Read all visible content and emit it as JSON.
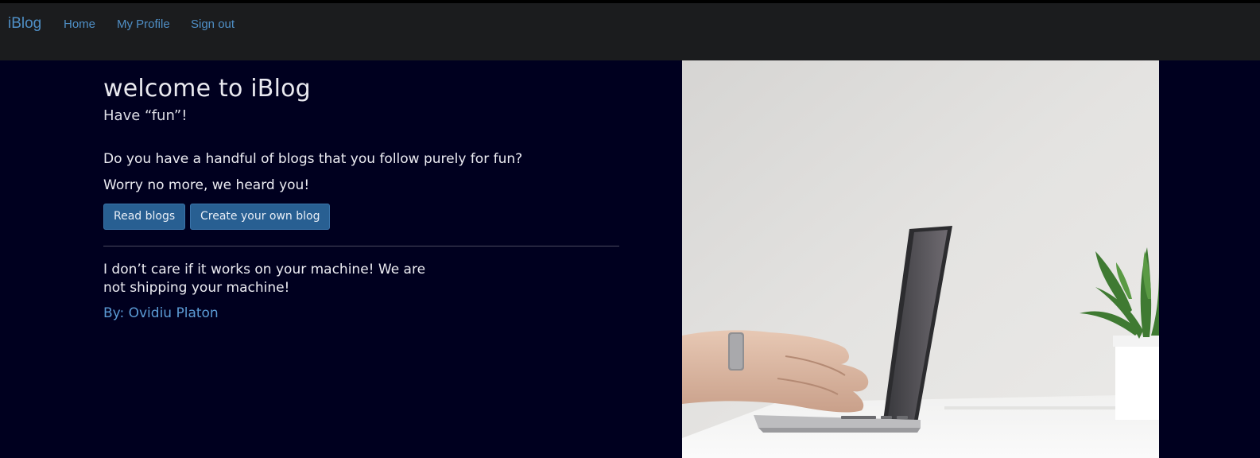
{
  "navbar": {
    "brand": "iBlog",
    "links": [
      {
        "label": "Home"
      },
      {
        "label": "My Profile"
      },
      {
        "label": "Sign out"
      }
    ]
  },
  "hero": {
    "title": "welcome to iBlog",
    "subtitle": "Have “fun”!",
    "question": "Do you have a handful of blogs that you follow purely for fun?",
    "reassurance": "Worry no more, we heard you!",
    "buttons": {
      "read_label": "Read blogs",
      "create_label": "Create your own blog"
    },
    "quote": "I don’t care if it works on your machine! We are not shipping your machine!",
    "author": "By: Ovidiu Platon"
  },
  "colors": {
    "page_background": "#00001f",
    "navbar_background": "#1b1c1e",
    "link": "#4f8fc6",
    "button": "#285f92",
    "author": "#5b9bd5"
  },
  "icons": {
    "hero_image": "laptop-typing-photo"
  }
}
